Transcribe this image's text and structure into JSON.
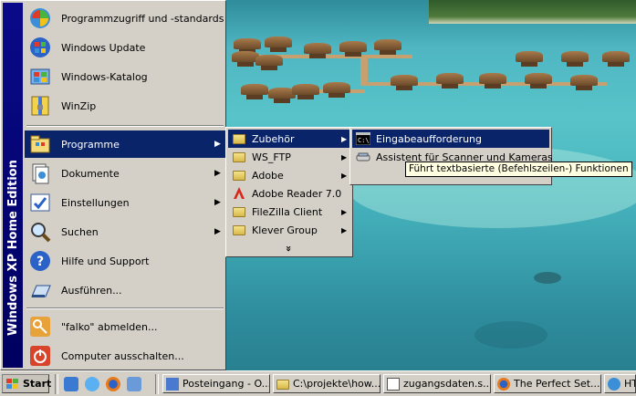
{
  "sidebar": {
    "title": "Windows XP Home Edition"
  },
  "start_menu": {
    "pinned": [
      {
        "label": "Programmzugriff und -standards",
        "icon": "program-access-icon"
      },
      {
        "label": "Windows Update",
        "icon": "windows-update-icon"
      },
      {
        "label": "Windows-Katalog",
        "icon": "windows-catalog-icon"
      },
      {
        "label": "WinZip",
        "icon": "winzip-icon"
      }
    ],
    "items": [
      {
        "label": "Programme",
        "icon": "programs-folder-icon",
        "has_submenu": true,
        "highlighted": true
      },
      {
        "label": "Dokumente",
        "icon": "documents-icon",
        "has_submenu": true
      },
      {
        "label": "Einstellungen",
        "icon": "settings-icon",
        "has_submenu": true
      },
      {
        "label": "Suchen",
        "icon": "search-icon",
        "has_submenu": true
      },
      {
        "label": "Hilfe und Support",
        "icon": "help-icon"
      },
      {
        "label": "Ausführen...",
        "icon": "run-icon"
      }
    ],
    "logoff": {
      "label": "\"falko\" abmelden...",
      "icon": "key-icon"
    },
    "shutdown": {
      "label": "Computer ausschalten...",
      "icon": "power-icon"
    }
  },
  "programs_menu": {
    "items": [
      {
        "label": "Zubehör",
        "icon": "folder-icon",
        "has_submenu": true,
        "highlighted": true
      },
      {
        "label": "WS_FTP",
        "icon": "folder-icon",
        "has_submenu": true
      },
      {
        "label": "Adobe",
        "icon": "folder-icon",
        "has_submenu": true
      },
      {
        "label": "Adobe Reader 7.0",
        "icon": "adobe-reader-icon"
      },
      {
        "label": "FileZilla Client",
        "icon": "folder-icon",
        "has_submenu": true
      },
      {
        "label": "Klever Group",
        "icon": "folder-icon",
        "has_submenu": true
      }
    ],
    "expand": "»"
  },
  "accessories_menu": {
    "items": [
      {
        "label": "Eingabeaufforderung",
        "icon": "command-prompt-icon",
        "highlighted": true
      },
      {
        "label": "Assistent für Scanner und Kameras",
        "icon": "scanner-icon"
      }
    ]
  },
  "tooltip": "Führt textbasierte (Befehlszeilen-) Funktionen aus.",
  "taskbar": {
    "start_label": "Start",
    "quick_launch": [
      "show-desktop-icon",
      "internet-explorer-icon",
      "firefox-icon",
      "outlook-express-icon"
    ],
    "tasks": [
      {
        "label": "Posteingang - O...",
        "icon": "outlook-icon"
      },
      {
        "label": "C:\\projekte\\how...",
        "icon": "folder-icon"
      },
      {
        "label": "zugangsdaten.s...",
        "icon": "document-icon"
      },
      {
        "label": "The Perfect Set...",
        "icon": "firefox-icon"
      },
      {
        "label": "HT...",
        "icon": "html-icon"
      }
    ]
  },
  "colors": {
    "menu_bg": "#d4d0c8",
    "highlight": "#0a246a",
    "sidebar": "#000080",
    "tooltip_bg": "#ffffe1"
  }
}
